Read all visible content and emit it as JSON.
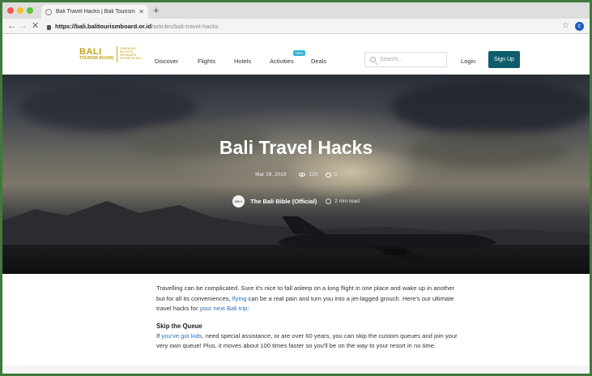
{
  "browser": {
    "tab_title": "Bali Travel Hacks | Bali Tourism",
    "url_host": "https://bali.balitourismboard.or.id",
    "url_path": "/articles/bali-travel-hacks",
    "profile_initial": "c"
  },
  "logo": {
    "main": "BALI",
    "sub": "TOURISM BOARD",
    "gov": "GABUNGAN INDUSTRI PARIWISATA INDONESIA BALI"
  },
  "nav": {
    "discover": "Discover",
    "flights": "Flights",
    "hotels": "Hotels",
    "activities": "Activities",
    "activities_badge": "NEW",
    "deals": "Deals"
  },
  "search": {
    "placeholder": "Search..."
  },
  "auth": {
    "login": "Login",
    "signup": "Sign Up"
  },
  "hero": {
    "title": "Bali Travel Hacks",
    "date": "Mar 29, 2019",
    "views": "120",
    "comments": "0",
    "avatar_text": "BIBLE",
    "author": "The Bali Bible (Official)",
    "read_time": "2 min read"
  },
  "article": {
    "p1_a": "Travelling can be complicated. Sure it's nice to fall asleep on a long flight in one place and wake up in another but for all its conveniences, ",
    "p1_link1": "flying",
    "p1_b": " can be a real pain and turn you into a jet-lagged grouch. Here's our ultimate travel hacks for ",
    "p1_link2": "your next Bali trip",
    "p1_c": ":",
    "h1": "Skip the Queue",
    "p2_a": "If ",
    "p2_link": "you've got kids",
    "p2_b": ", need special assistance, or are over 60 years, you can skip the custom queues and join your very own queue! Plus, it moves about 100 times faster so you'll be on the way to your resort in no time."
  },
  "colors": {
    "brand_gold": "#c4a21d",
    "signup_bg": "#0e5c6b",
    "link": "#2d72b8",
    "new_badge": "#34b3d9"
  }
}
